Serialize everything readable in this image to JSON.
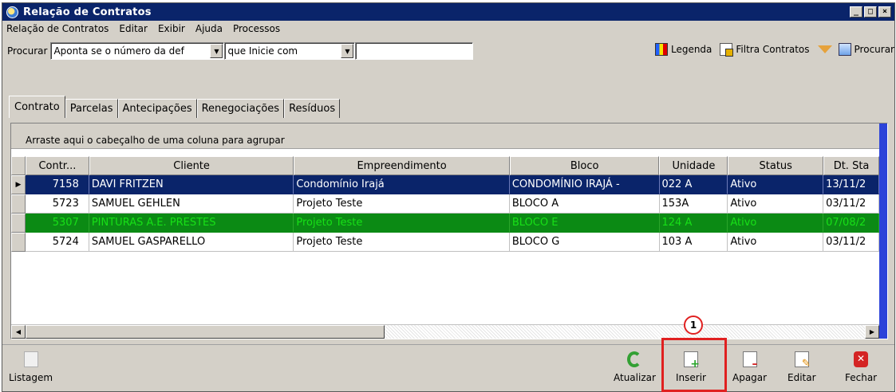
{
  "window": {
    "title": "Relação de Contratos",
    "controls": {
      "minimize": "_",
      "maximize": "□",
      "close": "×"
    }
  },
  "menu": [
    "Relação de Contratos",
    "Editar",
    "Exibir",
    "Ajuda",
    "Processos"
  ],
  "search": {
    "label": "Procurar",
    "field": "Aponta se o número da def",
    "mode": "que Inicie com",
    "value": ""
  },
  "toolbar_right": {
    "legend": "Legenda",
    "filter": "Filtra Contratos",
    "find": "Procurar"
  },
  "tabs": [
    "Contrato",
    "Parcelas",
    "Antecipações",
    "Renegociações",
    "Resíduos"
  ],
  "group_hint": "Arraste aqui o cabeçalho de uma coluna para agrupar",
  "grid": {
    "columns": [
      "Contr...",
      "Cliente",
      "Empreendimento",
      "Bloco",
      "Unidade",
      "Status",
      "Dt. Sta"
    ],
    "rows": [
      {
        "cells": [
          "7158",
          "DAVI FRITZEN",
          "Condomínio Irajá",
          "CONDOMÍNIO IRAJÁ -",
          "022 A",
          "Ativo",
          "13/11/2"
        ],
        "state": "selected"
      },
      {
        "cells": [
          "5723",
          "SAMUEL GEHLEN",
          "Projeto Teste",
          "BLOCO A",
          "153A",
          "Ativo",
          "03/11/2"
        ],
        "state": "normal"
      },
      {
        "cells": [
          "5307",
          "PINTURAS A.E. PRESTES",
          "Projeto Teste",
          "BLOCO E",
          "124 A",
          "Ativo",
          "07/08/2"
        ],
        "state": "green"
      },
      {
        "cells": [
          "5724",
          "SAMUEL GASPARELLO",
          "Projeto Teste",
          "BLOCO G",
          "103 A",
          "Ativo",
          "03/11/2"
        ],
        "state": "normal"
      }
    ]
  },
  "bottom": {
    "listagem": "Listagem",
    "atualizar": "Atualizar",
    "inserir": "Inserir",
    "apagar": "Apagar",
    "editar": "Editar",
    "fechar": "Fechar"
  },
  "annotation": {
    "number": "1",
    "color": "#e02020"
  },
  "colors": {
    "title_bar": "#0a246a",
    "selected_row": "#0a246a",
    "green_row": "#0b8a14",
    "scroll_blue": "#2c43d9"
  }
}
